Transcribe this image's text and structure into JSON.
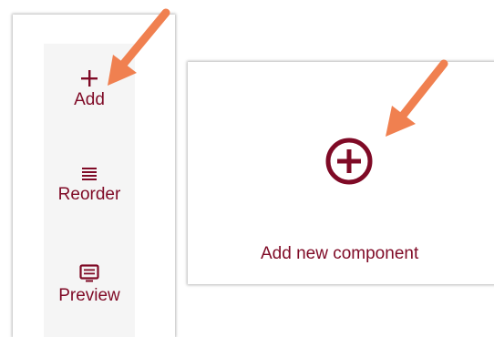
{
  "toolbar": {
    "add_label": "Add",
    "reorder_label": "Reorder",
    "preview_label": "Preview",
    "icons": {
      "add": "plus-icon",
      "reorder": "reorder-lines-icon",
      "preview": "preview-monitor-icon"
    }
  },
  "card": {
    "add_component_label": "Add new component",
    "icon": "circle-plus-icon"
  },
  "colors": {
    "accent": "#7f0a26",
    "arrow": "#f08050",
    "strip_background": "#f5f5f5"
  },
  "annotations": {
    "arrow_icon": "callout-arrow-icon"
  }
}
